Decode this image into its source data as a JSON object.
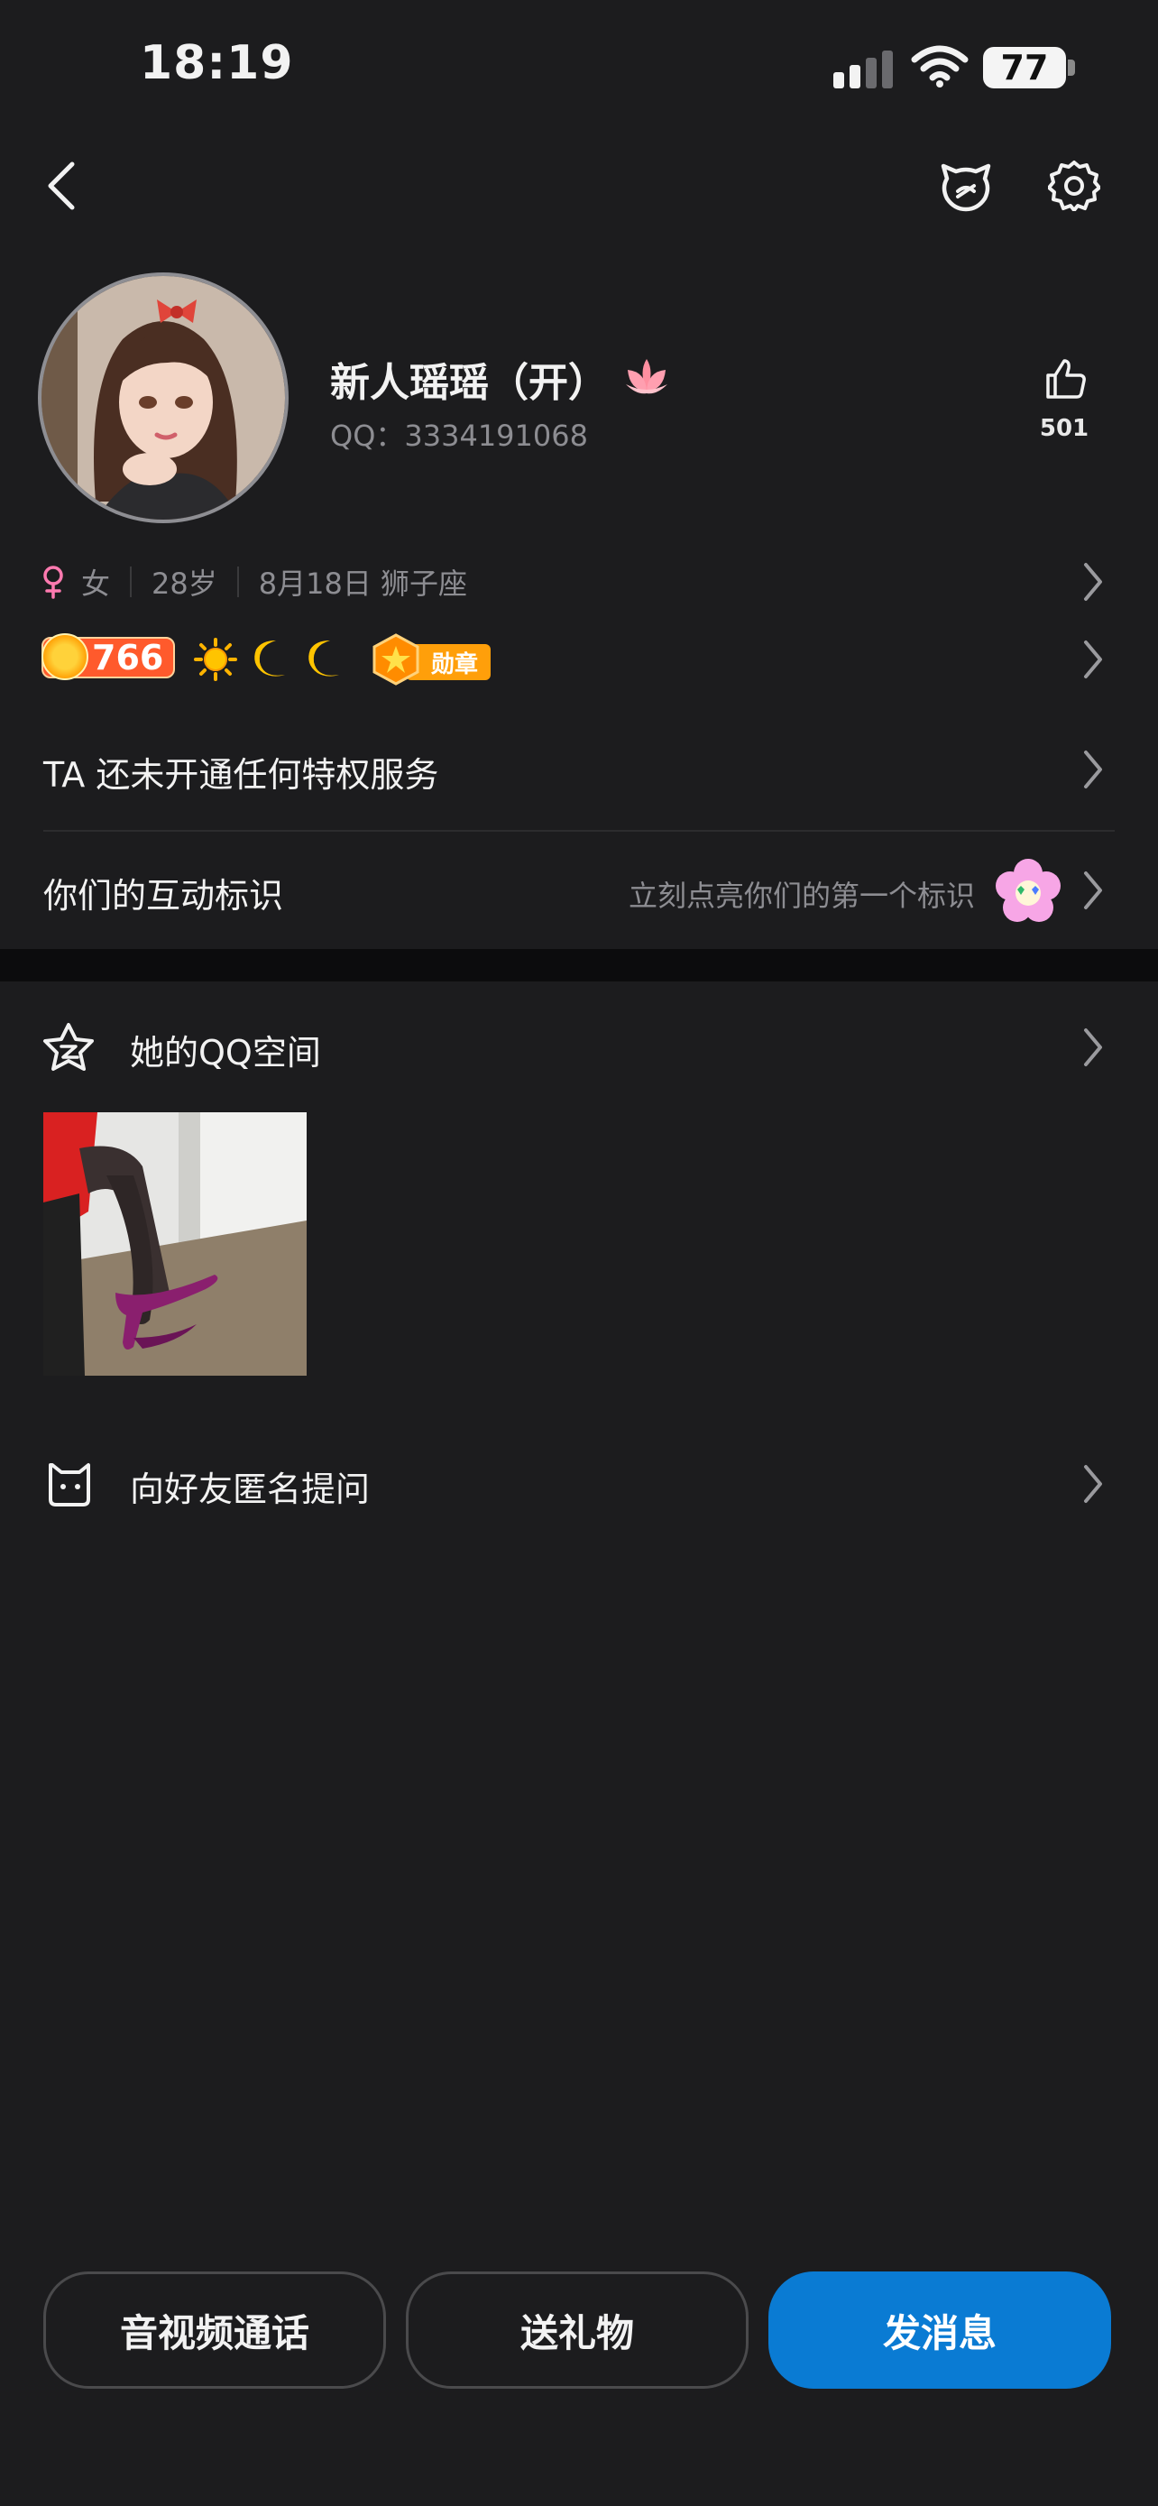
{
  "status_bar": {
    "time": "18:19",
    "battery": "77"
  },
  "profile": {
    "name": "新人瑶瑶（开）",
    "qq": "QQ：3334191068",
    "likes": "501",
    "gender": "女",
    "age": "28岁",
    "birthday": "8月18日 狮子座",
    "level": "766",
    "medal_label": "勋章"
  },
  "rows": {
    "privilege": "TA 还未开通任何特权服务",
    "interaction_title": "你们的互动标识",
    "interaction_hint": "立刻点亮你们的第一个标识",
    "qzone": "她的QQ空间",
    "anonymous_question": "向好友匿名提问"
  },
  "actions": {
    "call": "音视频通话",
    "gift": "送礼物",
    "message": "发消息"
  },
  "colors": {
    "accent": "#0a7bd3",
    "background": "#1c1c1e",
    "level_badge": "#ff5a2c",
    "medal": "#ff9f0a"
  },
  "icons": [
    "back-icon",
    "pet-icon",
    "settings-icon",
    "lotus-icon",
    "like-icon",
    "female-icon",
    "sun-icon",
    "moon-icon",
    "medal-icon",
    "chevron-right-icon",
    "star-face-icon",
    "flower-icon",
    "cat-icon",
    "signal-icon",
    "wifi-icon",
    "battery-icon"
  ]
}
